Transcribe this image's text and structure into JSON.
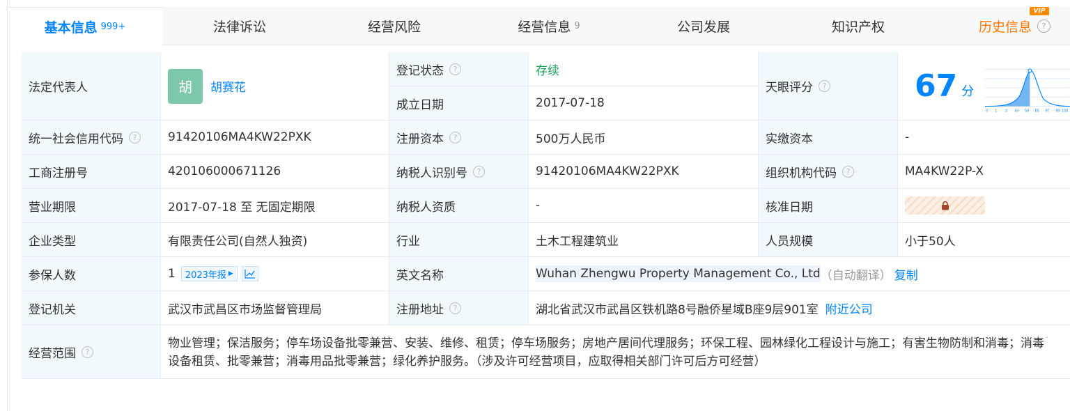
{
  "tabs": [
    {
      "label": "基本信息",
      "count": "999+"
    },
    {
      "label": "法律诉讼"
    },
    {
      "label": "经营风险"
    },
    {
      "label": "经营信息",
      "count": "9"
    },
    {
      "label": "公司发展"
    },
    {
      "label": "知识产权"
    },
    {
      "label": "历史信息",
      "badge": "VIP"
    }
  ],
  "info": {
    "legal_rep_label": "法定代表人",
    "legal_rep_avatar": "胡",
    "legal_rep_name": "胡赛花",
    "reg_status_label": "登记状态",
    "reg_status": "存续",
    "est_date_label": "成立日期",
    "est_date": "2017-07-18",
    "tianyan_label": "天眼评分",
    "score": "67",
    "score_unit": "分",
    "credit_code_label": "统一社会信用代码",
    "credit_code": "91420106MA4KW22PXK",
    "reg_capital_label": "注册资本",
    "reg_capital": "500万人民币",
    "paid_capital_label": "实缴资本",
    "paid_capital": "-",
    "biz_reg_no_label": "工商注册号",
    "biz_reg_no": "420106000671126",
    "taxpayer_id_label": "纳税人识别号",
    "taxpayer_id": "91420106MA4KW22PXK",
    "org_code_label": "组织机构代码",
    "org_code": "MA4KW22P-X",
    "term_label": "营业期限",
    "term": "2017-07-18 至 无固定期限",
    "taxpayer_qual_label": "纳税人资质",
    "taxpayer_qual": "-",
    "approval_date_label": "核准日期",
    "type_label": "企业类型",
    "type": "有限责任公司(自然人独资)",
    "industry_label": "行业",
    "industry": "土木工程建筑业",
    "staff_label": "人员规模",
    "staff": "小于50人",
    "insured_label": "参保人数",
    "insured": "1",
    "insured_report": "2023年报",
    "en_name_label": "英文名称",
    "en_name": "Wuhan Zhengwu Property Management Co., Ltd",
    "en_auto": "（自动翻译）",
    "copy": "复制",
    "authority_label": "登记机关",
    "authority": "武汉市武昌区市场监督管理局",
    "address_label": "注册地址",
    "address": "湖北省武汉市武昌区铁机路8号融侨星域B座9层901室",
    "nearby": "附近公司",
    "scope_label": "经营范围",
    "scope_line1": "物业管理；保洁服务；停车场设备批零兼营、安装、维修、租赁；停车场服务；房地产居间代理服务；环保工程、园林绿化工程设计与施工；有害生物防制和消毒；消毒",
    "scope_line2": "设备租赁、批零兼营；消毒用品批零兼营；绿化养护服务。（涉及许可经营项目，应取得相关部门许可后方可经营）"
  },
  "score_chart": {
    "type": "area",
    "x": [
      "0",
      "1",
      "3",
      "15",
      "50",
      "85",
      "97",
      "99",
      "100"
    ],
    "marker_at": "67",
    "colors": {
      "fill": "#5aa9f0",
      "line": "#0084ff"
    }
  },
  "colors": {
    "accent": "#0084ff",
    "label_bg": "#f2f9fc",
    "status_green": "#1aa35e",
    "history_orange": "#ff7a00"
  }
}
